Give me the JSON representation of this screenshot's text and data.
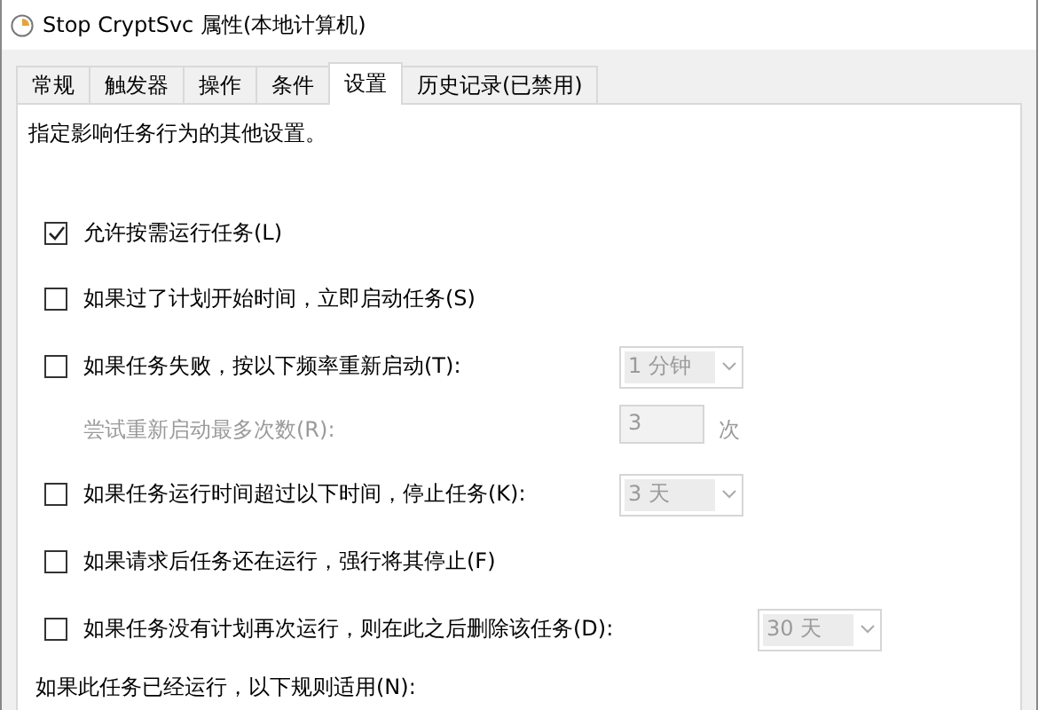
{
  "window": {
    "title": "Stop CryptSvc 属性(本地计算机)"
  },
  "tabs": [
    {
      "label": "常规",
      "selected": false
    },
    {
      "label": "触发器",
      "selected": false
    },
    {
      "label": "操作",
      "selected": false
    },
    {
      "label": "条件",
      "selected": false
    },
    {
      "label": "设置",
      "selected": true
    },
    {
      "label": "历史记录(已禁用)",
      "selected": false
    }
  ],
  "description": "指定影响任务行为的其他设置。",
  "rows": [
    {
      "kind": "check",
      "label": "允许按需运行任务(L)",
      "checked": true
    },
    {
      "kind": "check",
      "label": "如果过了计划开始时间，立即启动任务(S)",
      "checked": false
    },
    {
      "kind": "check",
      "label": "如果任务失败，按以下频率重新启动(T):",
      "checked": false,
      "select": {
        "value": "1 分钟",
        "disabled": true
      }
    },
    {
      "kind": "sub",
      "label": "尝试重新启动最多次数(R):",
      "disabled": true,
      "input": {
        "value": "3",
        "disabled": true
      },
      "unit": "次"
    },
    {
      "kind": "check",
      "label": "如果任务运行时间超过以下时间，停止任务(K):",
      "checked": false,
      "select": {
        "value": "3 天",
        "disabled": true
      }
    },
    {
      "kind": "check",
      "label": "如果请求后任务还在运行，强行将其停止(F)",
      "checked": false
    },
    {
      "kind": "check",
      "label": "如果任务没有计划再次运行，则在此之后删除该任务(D):",
      "checked": false,
      "select": {
        "value": "30 天",
        "disabled": true
      }
    },
    {
      "kind": "note",
      "label": "如果此任务已经运行，以下规则适用(N):"
    }
  ]
}
